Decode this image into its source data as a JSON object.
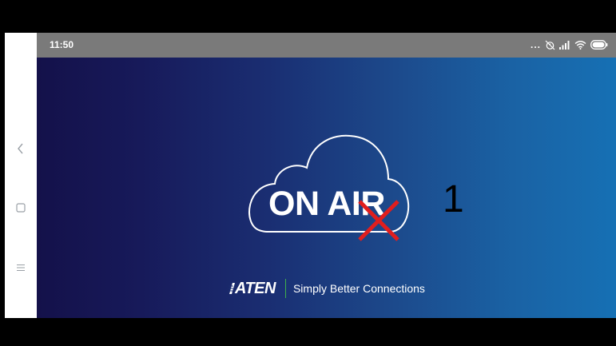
{
  "status_bar": {
    "time": "11:50",
    "dots": "...",
    "icons": [
      "alarm-off-icon",
      "signal-icon",
      "wifi-icon",
      "battery-icon"
    ]
  },
  "nav": {
    "buttons": [
      "back-icon",
      "home-icon",
      "menu-icon"
    ]
  },
  "slide": {
    "title": "ON AIR",
    "number": "1",
    "brand": "ATEN",
    "tagline": "Simply Better Connections"
  },
  "colors": {
    "gradient_left": "#14114a",
    "gradient_right": "#1670b4",
    "status_bar": "#7a7a7a",
    "x_mark": "#e01e1e",
    "divider": "#3fb04a"
  }
}
